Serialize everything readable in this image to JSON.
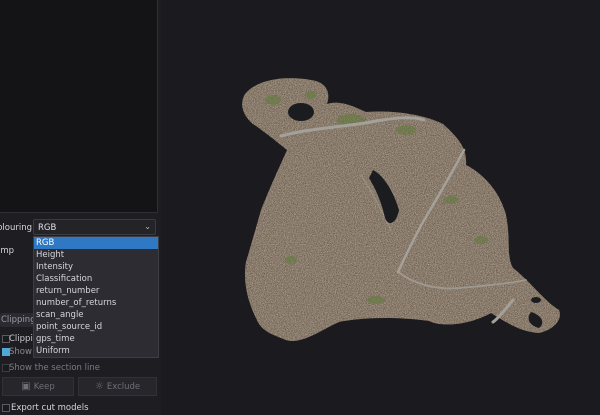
{
  "panel": {
    "colouring_label": "Colouring",
    "ramp_label": "Ramp",
    "colouring_value": "RGB",
    "chevron_glyph": "⌄",
    "colouring_options": [
      "RGB",
      "Height",
      "Intensity",
      "Classification",
      "return_number",
      "number_of_returns",
      "scan_angle",
      "point_source_id",
      "gps_time",
      "Uniform"
    ],
    "selected_option": "RGB",
    "clipping_tab": "Clipping b",
    "clipping_check_label": "Clipping",
    "clipping_check_checked": false,
    "show_check_label": "Show th",
    "show_check_checked": true,
    "section_line_label": "Show the section line",
    "section_line_checked": false,
    "keep_button": "Keep",
    "keep_icon": "▣",
    "exclude_button": "Exclude",
    "exclude_icon": "☼",
    "export_label": "Export cut models",
    "export_checked": false
  },
  "viewport": {
    "content": "point-cloud-aerial-forest",
    "colors": {
      "background": "#1b1b1f",
      "forest": "#6b5a49",
      "road": "#a4a09a",
      "water": "#1a1c20"
    }
  },
  "colors": {
    "selected": "#2f78c4",
    "accent": "#4fa8d8"
  }
}
